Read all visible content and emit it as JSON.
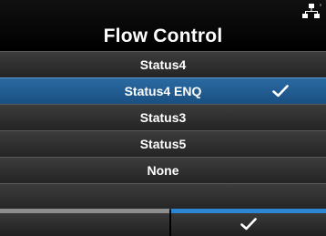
{
  "header": {
    "title": "Flow Control",
    "status_icon": "network-icon"
  },
  "options": [
    {
      "label": "Status4",
      "selected": false
    },
    {
      "label": "Status4 ENQ",
      "selected": true
    },
    {
      "label": "Status3",
      "selected": false
    },
    {
      "label": "Status5",
      "selected": false
    },
    {
      "label": "None",
      "selected": false
    }
  ],
  "footer": {
    "left_key": "",
    "right_key_icon": "checkmark-icon"
  },
  "colors": {
    "selected_row": "#1f5a90",
    "row": "#2f2f2f",
    "accent_bar": "#2d86d2",
    "inactive_bar": "#8d8d8d"
  }
}
